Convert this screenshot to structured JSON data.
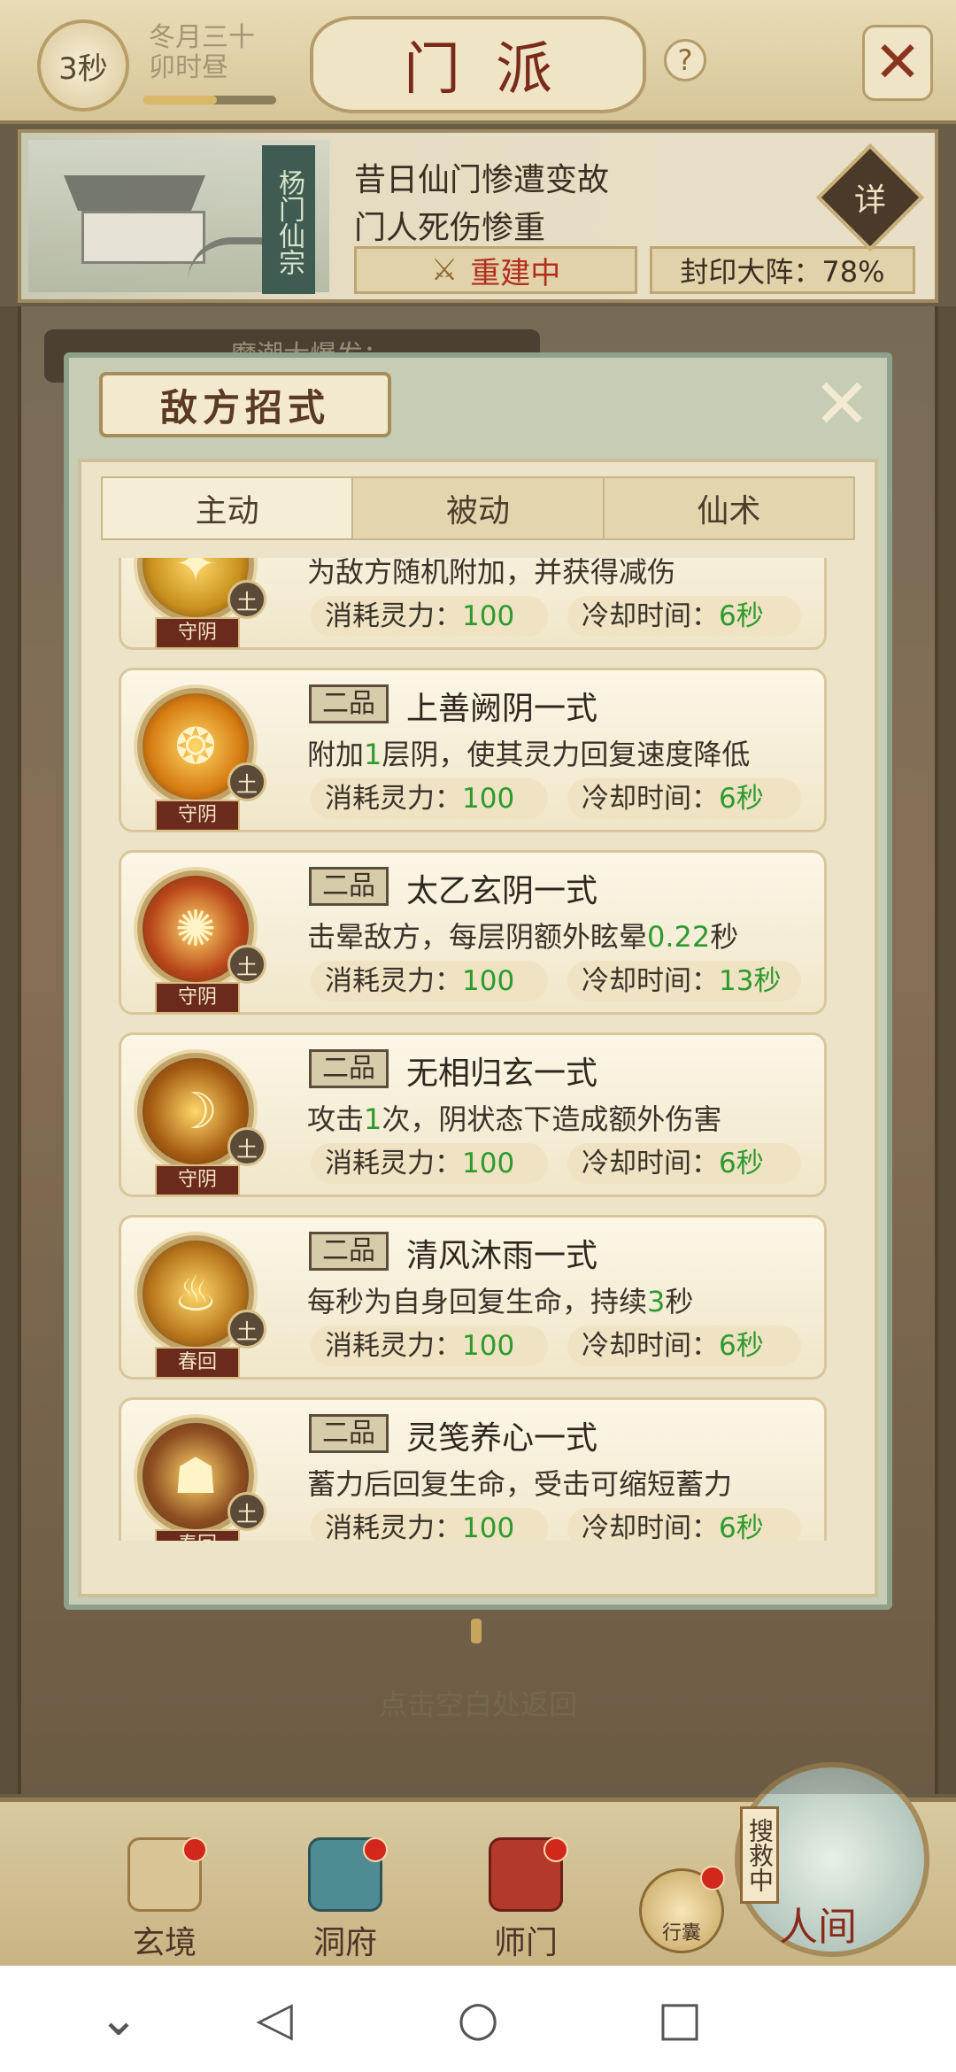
{
  "header": {
    "timer": "3秒",
    "date_line1": "冬月三十",
    "date_line2": "卯时昼",
    "title": "门派",
    "help": "?",
    "close": "✕"
  },
  "banner": {
    "sect_name": "杨门仙宗",
    "line1": "昔日仙门惨遭变故",
    "line2": "门人死伤惨重",
    "rebuild_label": "重建中",
    "seal_label": "封印大阵：78%",
    "detail_label": "详"
  },
  "background": {
    "tag_text": "魔潮大爆发：一",
    "back_hint": "点击空白处返回"
  },
  "modal": {
    "title": "敌方招式",
    "tabs": [
      {
        "label": "主动"
      },
      {
        "label": "被动"
      },
      {
        "label": "仙术"
      }
    ],
    "skills": [
      {
        "grade": "",
        "name": "",
        "desc_pre": "为敌方随机附加，并获得减伤",
        "desc_hl": "",
        "desc_post": "",
        "cost_label": "消耗灵力：",
        "cost": "100",
        "cd_label": "冷却时间：",
        "cd": "6秒",
        "element": "土",
        "ribbon": "守阴",
        "icon_color": "#c8901c",
        "glyph": "✦"
      },
      {
        "grade": "二品",
        "name": "上善阙阴一式",
        "desc_pre": "附加",
        "desc_hl": "1",
        "desc_post": "层阴，使其灵力回复速度降低",
        "cost_label": "消耗灵力：",
        "cost": "100",
        "cd_label": "冷却时间：",
        "cd": "6秒",
        "element": "土",
        "ribbon": "守阴",
        "icon_color": "#d77e12",
        "glyph": "❂"
      },
      {
        "grade": "二品",
        "name": "太乙玄阴一式",
        "desc_pre": "击晕敌方，每层阴额外眩晕",
        "desc_hl": "0.22",
        "desc_post": "秒",
        "cost_label": "消耗灵力：",
        "cost": "100",
        "cd_label": "冷却时间：",
        "cd": "13秒",
        "element": "土",
        "ribbon": "守阴",
        "icon_color": "#b9461a",
        "glyph": "✺"
      },
      {
        "grade": "二品",
        "name": "无相归玄一式",
        "desc_pre": "攻击",
        "desc_hl": "1",
        "desc_post": "次，阴状态下造成额外伤害",
        "cost_label": "消耗灵力：",
        "cost": "100",
        "cd_label": "冷却时间：",
        "cd": "6秒",
        "element": "土",
        "ribbon": "守阴",
        "icon_color": "#a65d12",
        "glyph": "☽"
      },
      {
        "grade": "二品",
        "name": "清风沐雨一式",
        "desc_pre": "每秒为自身回复生命，持续",
        "desc_hl": "3",
        "desc_post": "秒",
        "cost_label": "消耗灵力：",
        "cost": "100",
        "cd_label": "冷却时间：",
        "cd": "6秒",
        "element": "土",
        "ribbon": "春回",
        "icon_color": "#b7761c",
        "glyph": "♨"
      },
      {
        "grade": "二品",
        "name": "灵笺养心一式",
        "desc_pre": "蓄力后回复生命，受击可缩短蓄力",
        "desc_hl": "",
        "desc_post": "",
        "cost_label": "消耗灵力：",
        "cost": "100",
        "cd_label": "冷却时间：",
        "cd": "6秒",
        "element": "土",
        "ribbon": "春回",
        "icon_color": "#8e4e22",
        "glyph": "☗"
      }
    ]
  },
  "bottom_nav": {
    "items": [
      {
        "label": "玄境"
      },
      {
        "label": "洞府"
      },
      {
        "label": "师门"
      }
    ],
    "bag_label": "行囊",
    "search_tag": "搜救中",
    "world_label": "人间"
  },
  "system_nav": {
    "down": "⌄",
    "back": "◁",
    "home": "○",
    "recent": "□"
  }
}
